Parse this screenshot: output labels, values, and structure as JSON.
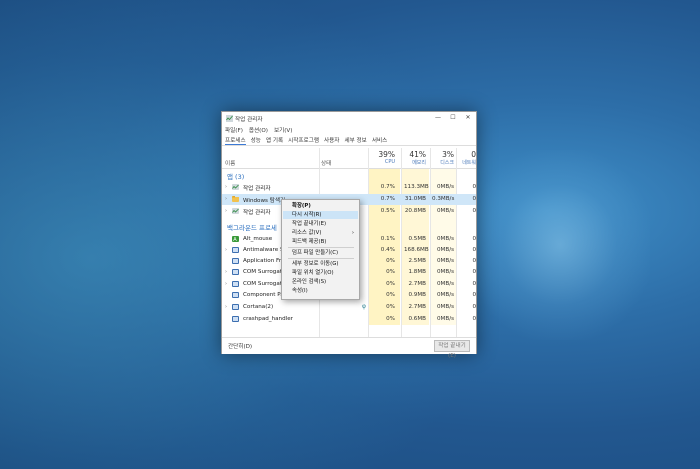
{
  "window": {
    "title": "작업 관리자",
    "controls": {
      "minimize": "—",
      "maximize": "☐",
      "close": "✕"
    }
  },
  "menubar": [
    "파일(F)",
    "옵션(O)",
    "보기(V)"
  ],
  "tabs": [
    "프로세스",
    "성능",
    "앱 기록",
    "시작프로그램",
    "사용자",
    "세부 정보",
    "서비스"
  ],
  "columns": {
    "name": "이름",
    "status": "상태",
    "cpu": {
      "pct": "39%",
      "label": "CPU"
    },
    "memory": {
      "pct": "41%",
      "label": "메모리"
    },
    "disk": {
      "pct": "3%",
      "label": "디스크"
    },
    "network": {
      "pct": "0",
      "label": "네트워"
    }
  },
  "groups": {
    "apps": "앱 (3)",
    "background": "백그라운드 프로세"
  },
  "apps": [
    {
      "name": "작업 관리자",
      "cpu": "0.7%",
      "mem": "113.3MB",
      "disk": "0MB/s",
      "net": "0"
    },
    {
      "name": "Windows 탐색기",
      "cpu": "0.7%",
      "mem": "31.0MB",
      "disk": "0.3MB/s",
      "net": "0"
    },
    {
      "name": "작업 관리자",
      "cpu": "0.5%",
      "mem": "20.8MB",
      "disk": "0MB/s",
      "net": "0"
    }
  ],
  "background": [
    {
      "name": "Alt_mouse",
      "cpu": "0.1%",
      "mem": "0.5MB",
      "disk": "0MB/s",
      "net": "0"
    },
    {
      "name": "Antimalware Se",
      "cpu": "0.4%",
      "mem": "168.6MB",
      "disk": "0MB/s",
      "net": "0"
    },
    {
      "name": "Application Fra",
      "cpu": "0%",
      "mem": "2.5MB",
      "disk": "0MB/s",
      "net": "0"
    },
    {
      "name": "COM Surrogate",
      "cpu": "0%",
      "mem": "1.8MB",
      "disk": "0MB/s",
      "net": "0"
    },
    {
      "name": "COM Surrogate",
      "cpu": "0%",
      "mem": "2.7MB",
      "disk": "0MB/s",
      "net": "0"
    },
    {
      "name": "Component Pa",
      "cpu": "0%",
      "mem": "0.9MB",
      "disk": "0MB/s",
      "net": "0"
    },
    {
      "name": "Cortana(2)",
      "cpu": "0%",
      "mem": "2.7MB",
      "disk": "0MB/s",
      "net": "0"
    },
    {
      "name": "crashpad_handler",
      "cpu": "0%",
      "mem": "0.6MB",
      "disk": "0MB/s",
      "net": "0"
    }
  ],
  "footer": {
    "less": "간단히(D)",
    "end_task": "작업 끝내기(E)"
  },
  "context_menu": {
    "expand": "확장(P)",
    "restart": "다시 시작(R)",
    "end_task": "작업 끝내기(E)",
    "resource_values": "리소스 값(V)",
    "feedback": "피드백 제공(B)",
    "dump": "덤프 파일 만들기(C)",
    "details": "세부 정보로 이동(G)",
    "open_location": "파일 위치 열기(O)",
    "search_online": "온라인 검색(S)",
    "properties": "속성(I)",
    "submenu_arrow": "›"
  },
  "colors": {
    "selection": "#cfe6f8",
    "cpu_highlight": "#fff4c4",
    "group_text": "#2b6fbf",
    "menu_highlight": "#cce4f7"
  }
}
